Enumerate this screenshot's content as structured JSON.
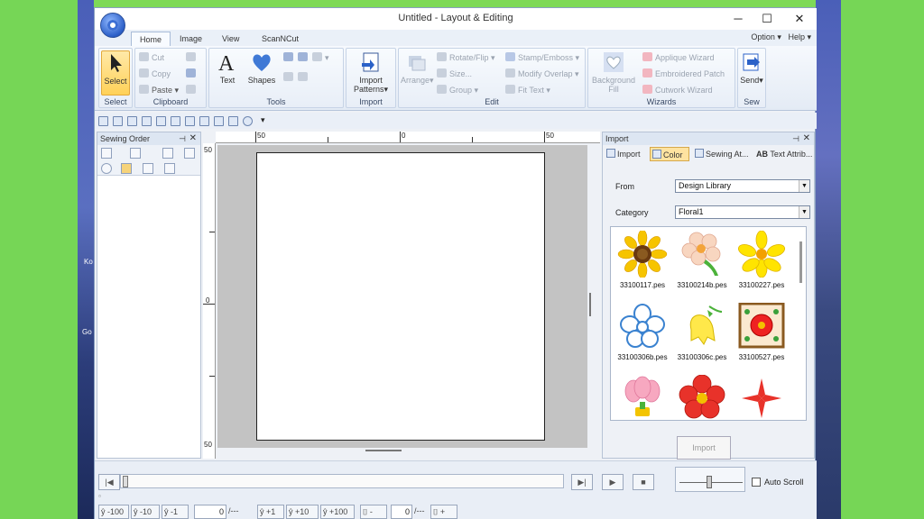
{
  "window": {
    "title": "Untitled - Layout & Editing",
    "minimize": "─",
    "maximize": "☐",
    "close": "✕"
  },
  "desktop": {
    "label_k": "Ko",
    "label_g": "Go"
  },
  "ribbon_tabs": [
    "Home",
    "Image",
    "View",
    "ScanNCut"
  ],
  "ribbon_right": {
    "option": "Option ▾",
    "help": "Help ▾"
  },
  "groups": {
    "select": {
      "label": "Select",
      "select_btn": "Select"
    },
    "clipboard": {
      "label": "Clipboard",
      "cut": "Cut",
      "copy": "Copy",
      "paste": "Paste"
    },
    "tools": {
      "label": "Tools",
      "text": "Text",
      "shapes": "Shapes"
    },
    "import": {
      "label": "Import",
      "import_patterns": "Import Patterns"
    },
    "edit": {
      "label": "Edit",
      "arrange": "Arrange",
      "rotate_flip": "Rotate/Flip",
      "size": "Size...",
      "group": "Group",
      "stamp_emboss": "Stamp/Emboss",
      "modify_overlap": "Modify Overlap",
      "fit_text": "Fit Text"
    },
    "wizards": {
      "label": "Wizards",
      "background_fill": "Background Fill",
      "applique": "Applique Wizard",
      "embroidered_patch": "Embroidered Patch",
      "cutwork": "Cutwork Wizard"
    },
    "sew": {
      "label": "Sew",
      "send": "Send"
    }
  },
  "sewing_order": {
    "title": "Sewing Order"
  },
  "ruler": {
    "top": [
      "50",
      "0",
      "50"
    ],
    "left": [
      "50",
      "0",
      "50"
    ]
  },
  "import_panel": {
    "title": "Import",
    "tabs": [
      "Import",
      "Color",
      "Sewing At...",
      "Text Attrib..."
    ],
    "from_label": "From",
    "from_value": "Design Library",
    "category_label": "Category",
    "category_value": "Floral1",
    "thumbs": [
      {
        "name": "33100117.pes",
        "icon": "sunflower-icon"
      },
      {
        "name": "33100214b.pes",
        "icon": "peach-flower-icon"
      },
      {
        "name": "33100227.pes",
        "icon": "yellow-flower-icon"
      },
      {
        "name": "33100306b.pes",
        "icon": "blue-flower-icon"
      },
      {
        "name": "33100306c.pes",
        "icon": "bellflower-icon"
      },
      {
        "name": "33100527.pes",
        "icon": "framed-flower-icon"
      },
      {
        "name": "",
        "icon": "pink-tulip-icon"
      },
      {
        "name": "",
        "icon": "red-flower-icon"
      },
      {
        "name": "",
        "icon": "red-star-flower-icon"
      }
    ],
    "import_btn": "Import"
  },
  "playback": {
    "auto_scroll": "Auto Scroll"
  },
  "steps": {
    "m100": "-100",
    "m10": "-10",
    "m1": "-1",
    "val1": "0",
    "p1": "+1",
    "p10": "+10",
    "p100": "+100",
    "val2": "0",
    "sep": "/---",
    "minus": "-",
    "plus": "+"
  },
  "colors": {
    "accent": "#ffd158",
    "bg_green": "#7ed957"
  }
}
